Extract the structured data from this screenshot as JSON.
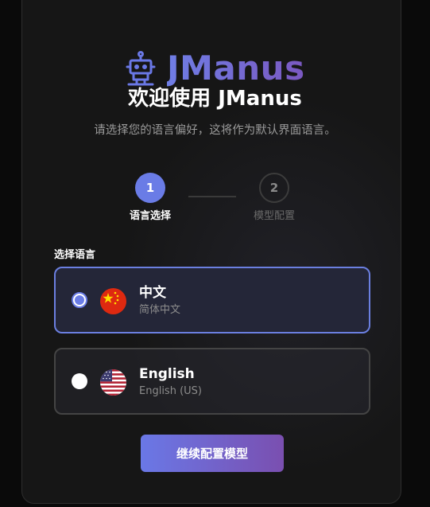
{
  "brand": {
    "name": "JManus",
    "icon": "robot-icon",
    "gradient": [
      "#6f7ee6",
      "#7a58c0"
    ]
  },
  "header": {
    "title": "欢迎使用 JManus",
    "subtitle": "请选择您的语言偏好，这将作为默认界面语言。"
  },
  "steps": [
    {
      "number": "1",
      "label": "语言选择",
      "active": true
    },
    {
      "number": "2",
      "label": "模型配置",
      "active": false
    }
  ],
  "language_section": {
    "label": "选择语言",
    "options": [
      {
        "name": "中文",
        "sub": "简体中文",
        "flag": "china-flag-icon",
        "selected": true
      },
      {
        "name": "English",
        "sub": "English (US)",
        "flag": "us-flag-icon",
        "selected": false
      }
    ]
  },
  "actions": {
    "continue_label": "继续配置模型"
  },
  "colors": {
    "accent": "#6a7ce6",
    "background": "#161616"
  }
}
